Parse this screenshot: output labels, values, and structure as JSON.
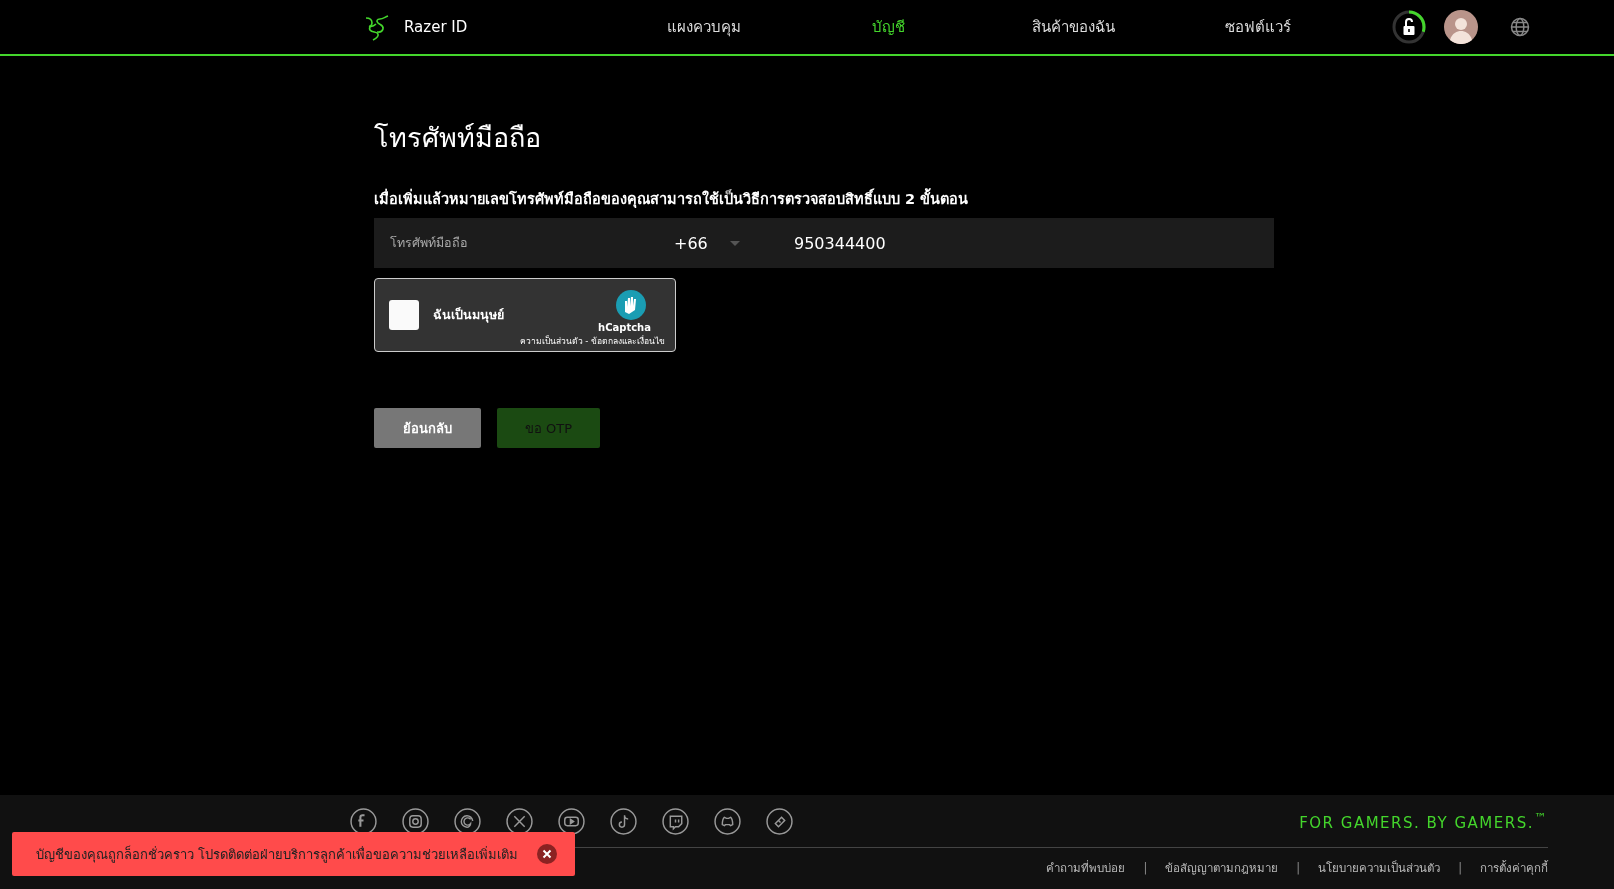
{
  "header": {
    "brand": "Razer ID",
    "nav": [
      {
        "label": "แผงควบคุม",
        "selected": false
      },
      {
        "label": "บัญชี",
        "selected": true
      },
      {
        "label": "สินค้าของฉัน",
        "selected": false
      },
      {
        "label": "ซอฟต์แวร์",
        "selected": false
      }
    ],
    "security_meter": {
      "level": 0.3
    }
  },
  "page": {
    "title": "โทรศัพท์มือถือ",
    "description": "เมื่อเพิ่มแล้วหมายเลขโทรศัพท์มือถือของคุณสามารถใช้เป็นวิธีการตรวจสอบสิทธิ์แบบ 2 ขั้นตอน",
    "phone_field": {
      "label": "โทรศัพท์มือถือ",
      "country_code": "+66",
      "value": "950344400"
    },
    "captcha": {
      "label": "ฉันเป็นมนุษย์",
      "checked": false,
      "brand": "hCaptcha",
      "links": "ความเป็นส่วนตัว - ข้อตกลงและเงื่อนไข"
    },
    "buttons": [
      {
        "label": "ย้อนกลับ",
        "kind": "secondary",
        "disabled": false
      },
      {
        "label": "ขอ OTP",
        "kind": "primary",
        "disabled": true
      }
    ]
  },
  "footer": {
    "social_icons": [
      {
        "kind": "facebook"
      },
      {
        "kind": "instagram"
      },
      {
        "kind": "threads"
      },
      {
        "kind": "x"
      },
      {
        "kind": "youtube"
      },
      {
        "kind": "tiktok"
      },
      {
        "kind": "twitch"
      },
      {
        "kind": "discord"
      },
      {
        "kind": "ticket"
      }
    ],
    "tagline": "FOR GAMERS. BY GAMERS.",
    "tagline_mark": "™",
    "link_separator": "|",
    "links": [
      "คำถามที่พบบ่อย",
      "ข้อสัญญาตามกฎหมาย",
      "นโยบายความเป็นส่วนตัว",
      "การตั้งค่าคุกกี้"
    ]
  },
  "toast": {
    "message": "บัญชีของคุณถูกล็อกชั่วคราว โปรดติดต่อฝ่ายบริการลูกค้าเพื่อขอความช่วยเหลือเพิ่มเติม"
  }
}
